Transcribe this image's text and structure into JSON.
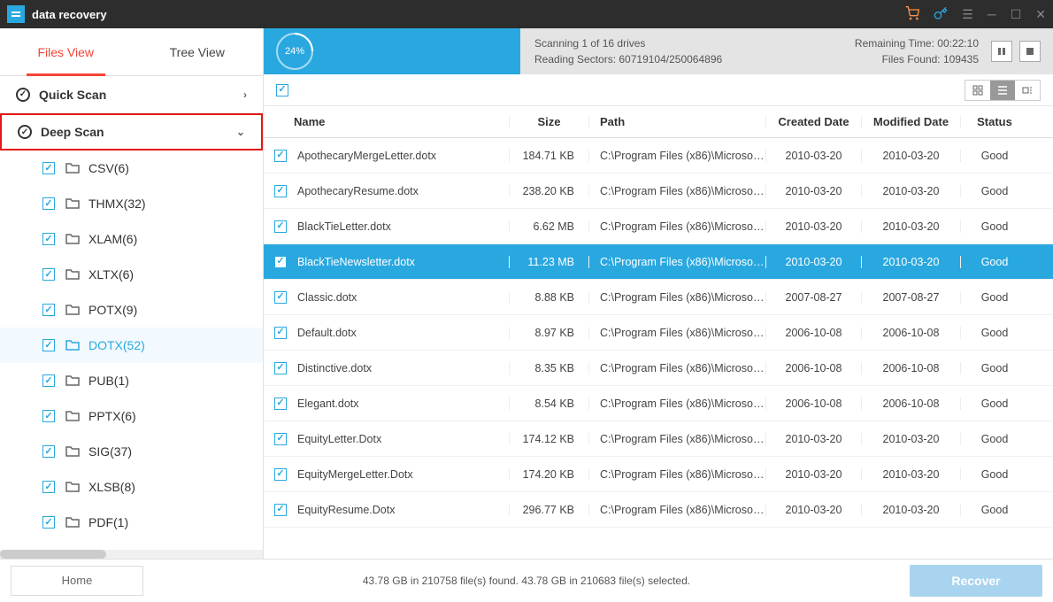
{
  "titlebar": {
    "title": "data recovery"
  },
  "tabs": {
    "files": "Files View",
    "tree": "Tree View"
  },
  "scan": {
    "quick": "Quick Scan",
    "deep": "Deep Scan",
    "percent": "24%",
    "line1": "Scanning 1 of  16 drives",
    "line2": "Reading Sectors: 60719104/250064896",
    "remain": "Remaining Time: 00:22:10",
    "found": "Files Found: 109435"
  },
  "filetypes": [
    {
      "label": "CSV(6)",
      "active": false
    },
    {
      "label": "THMX(32)",
      "active": false
    },
    {
      "label": "XLAM(6)",
      "active": false
    },
    {
      "label": "XLTX(6)",
      "active": false
    },
    {
      "label": "POTX(9)",
      "active": false
    },
    {
      "label": "DOTX(52)",
      "active": true
    },
    {
      "label": "PUB(1)",
      "active": false
    },
    {
      "label": "PPTX(6)",
      "active": false
    },
    {
      "label": "SIG(37)",
      "active": false
    },
    {
      "label": "XLSB(8)",
      "active": false
    },
    {
      "label": "PDF(1)",
      "active": false
    }
  ],
  "columns": {
    "name": "Name",
    "size": "Size",
    "path": "Path",
    "created": "Created Date",
    "modified": "Modified Date",
    "status": "Status"
  },
  "rows": [
    {
      "name": "ApothecaryMergeLetter.dotx",
      "size": "184.71 KB",
      "path": "C:\\Program Files (x86)\\Microsoft ...",
      "created": "2010-03-20",
      "modified": "2010-03-20",
      "status": "Good",
      "selected": false
    },
    {
      "name": "ApothecaryResume.dotx",
      "size": "238.20 KB",
      "path": "C:\\Program Files (x86)\\Microsoft ...",
      "created": "2010-03-20",
      "modified": "2010-03-20",
      "status": "Good",
      "selected": false
    },
    {
      "name": "BlackTieLetter.dotx",
      "size": "6.62 MB",
      "path": "C:\\Program Files (x86)\\Microsoft ...",
      "created": "2010-03-20",
      "modified": "2010-03-20",
      "status": "Good",
      "selected": false
    },
    {
      "name": "BlackTieNewsletter.dotx",
      "size": "11.23 MB",
      "path": "C:\\Program Files (x86)\\Microsoft ...",
      "created": "2010-03-20",
      "modified": "2010-03-20",
      "status": "Good",
      "selected": true
    },
    {
      "name": "Classic.dotx",
      "size": "8.88 KB",
      "path": "C:\\Program Files (x86)\\Microsoft ...",
      "created": "2007-08-27",
      "modified": "2007-08-27",
      "status": "Good",
      "selected": false
    },
    {
      "name": "Default.dotx",
      "size": "8.97 KB",
      "path": "C:\\Program Files (x86)\\Microsoft ...",
      "created": "2006-10-08",
      "modified": "2006-10-08",
      "status": "Good",
      "selected": false
    },
    {
      "name": "Distinctive.dotx",
      "size": "8.35 KB",
      "path": "C:\\Program Files (x86)\\Microsoft ...",
      "created": "2006-10-08",
      "modified": "2006-10-08",
      "status": "Good",
      "selected": false
    },
    {
      "name": "Elegant.dotx",
      "size": "8.54 KB",
      "path": "C:\\Program Files (x86)\\Microsoft ...",
      "created": "2006-10-08",
      "modified": "2006-10-08",
      "status": "Good",
      "selected": false
    },
    {
      "name": "EquityLetter.Dotx",
      "size": "174.12 KB",
      "path": "C:\\Program Files (x86)\\Microsoft ...",
      "created": "2010-03-20",
      "modified": "2010-03-20",
      "status": "Good",
      "selected": false
    },
    {
      "name": "EquityMergeLetter.Dotx",
      "size": "174.20 KB",
      "path": "C:\\Program Files (x86)\\Microsoft ...",
      "created": "2010-03-20",
      "modified": "2010-03-20",
      "status": "Good",
      "selected": false
    },
    {
      "name": "EquityResume.Dotx",
      "size": "296.77 KB",
      "path": "C:\\Program Files (x86)\\Microsoft ...",
      "created": "2010-03-20",
      "modified": "2010-03-20",
      "status": "Good",
      "selected": false
    }
  ],
  "footer": {
    "home": "Home",
    "status": "43.78 GB in 210758 file(s) found.   43.78 GB in 210683 file(s) selected.",
    "recover": "Recover"
  }
}
